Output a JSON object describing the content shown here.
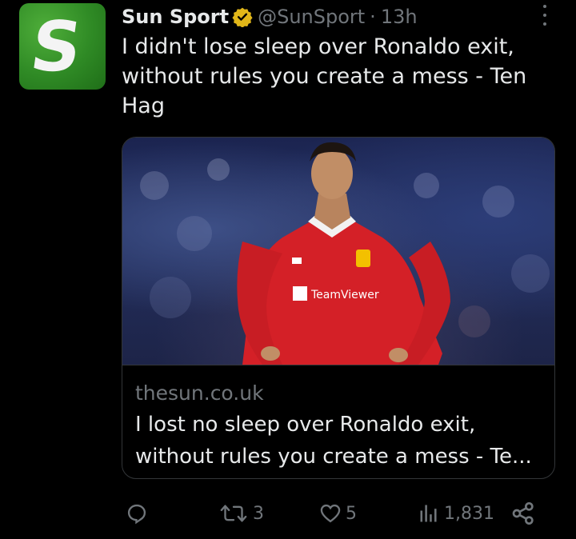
{
  "tweet": {
    "author_name": "Sun Sport",
    "handle": "@SunSport",
    "separator": "·",
    "time": "13h",
    "text": "I didn't lose sleep over Ronaldo exit, without rules you create a mess - Ten Hag",
    "avatar_letter": "S"
  },
  "card": {
    "domain": "thesun.co.uk",
    "title": "I lost no sleep over Ronaldo exit, without rules you create a mess - Te..."
  },
  "image": {
    "shirt_sponsor": "TeamViewer"
  },
  "actions": {
    "replies_icon": "reply-icon",
    "retweets": "3",
    "likes": "5",
    "views": "1,831"
  },
  "colors": {
    "background": "#000000",
    "text": "#e7e9ea",
    "muted": "#71767b",
    "border": "#333639",
    "verified": "#e2b719"
  }
}
